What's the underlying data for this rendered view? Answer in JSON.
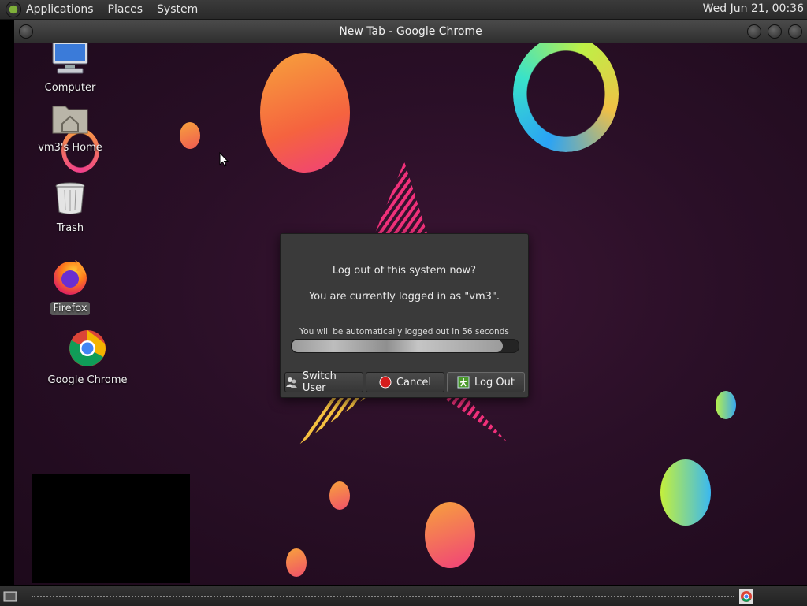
{
  "top_panel": {
    "menus": [
      "Applications",
      "Places",
      "System"
    ],
    "clock": "Wed Jun 21, 00:36"
  },
  "window": {
    "title": "New Tab - Google Chrome"
  },
  "desktop": {
    "icons": [
      {
        "label": "Computer",
        "icon": "computer-icon"
      },
      {
        "label": "vm3's Home",
        "icon": "home-folder-icon"
      },
      {
        "label": "Trash",
        "icon": "trash-icon"
      },
      {
        "label": "Firefox",
        "icon": "firefox-icon"
      },
      {
        "label": "Google Chrome",
        "icon": "chrome-icon"
      }
    ]
  },
  "dialog": {
    "question": "Log out of this system now?",
    "logged_in_as": "You are currently logged in as \"vm3\".",
    "countdown": "You will be automatically logged out in 56 seconds",
    "progress_percent": 93,
    "buttons": {
      "switch_user": "Switch User",
      "cancel": "Cancel",
      "log_out": "Log Out"
    }
  },
  "colors": {
    "wallpaper": "#2a0f27",
    "dialog_bg": "#3a3a3a",
    "accent_green": "#7fb03a"
  }
}
